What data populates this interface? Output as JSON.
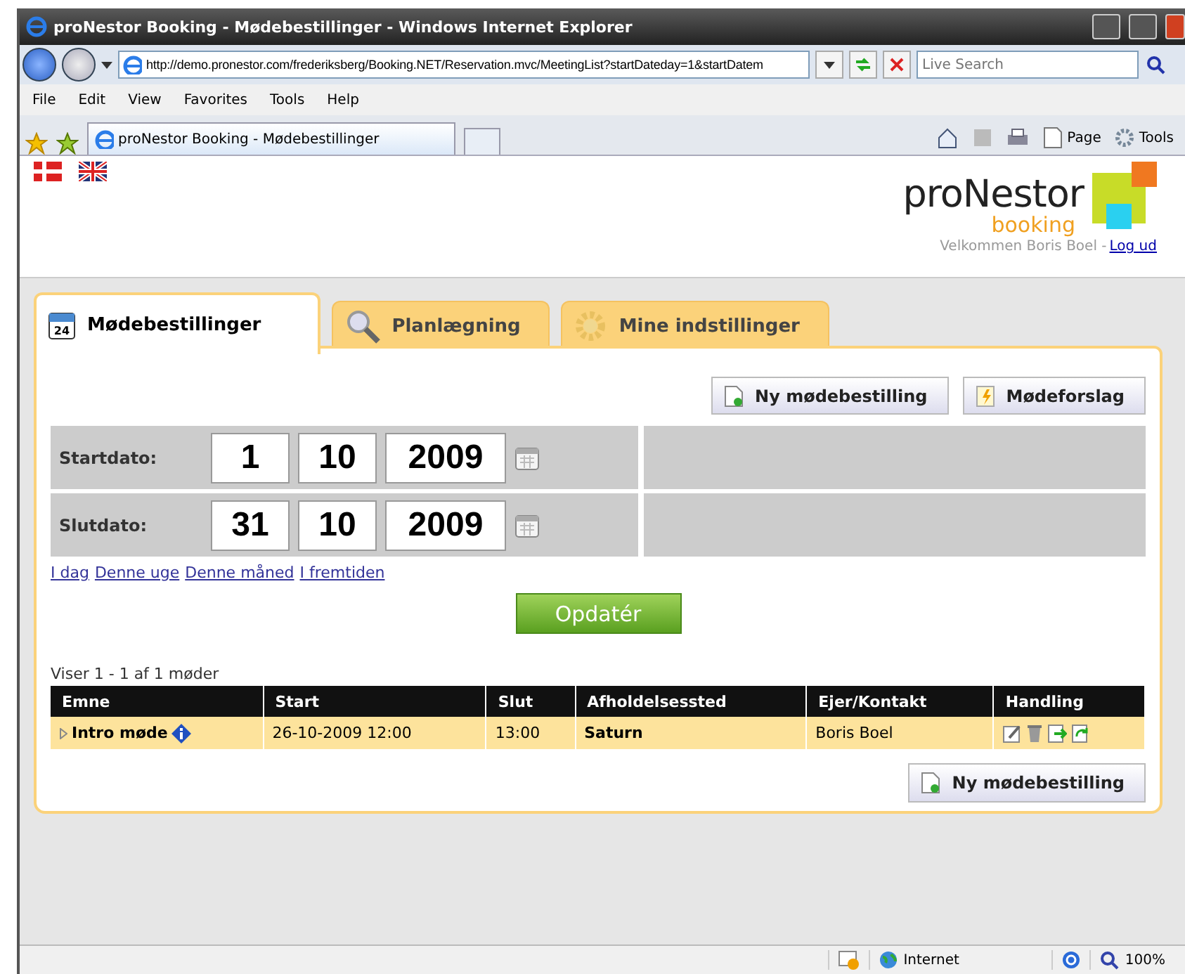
{
  "window": {
    "title": "proNestor Booking - Mødebestillinger - Windows Internet Explorer"
  },
  "address_bar": {
    "url": "http://demo.pronestor.com/frederiksberg/Booking.NET/Reservation.mvc/MeetingList?startDateday=1&startDatem"
  },
  "search": {
    "placeholder": "Live Search"
  },
  "menu": [
    "File",
    "Edit",
    "View",
    "Favorites",
    "Tools",
    "Help"
  ],
  "browser_tabs": [
    {
      "label": "proNestor Booking - Mødebestillinger",
      "selected": true
    }
  ],
  "command_bar": [
    "Page",
    "Tools"
  ],
  "page": {
    "logo": {
      "name": "proNestor",
      "sub": "booking"
    },
    "welcome": "Velkommen Boris Boel -",
    "logout": "Log ud",
    "tabs": [
      {
        "label": "Mødebestillinger",
        "kind": "calendar",
        "icon_text": "24",
        "selected": true
      },
      {
        "label": "Planlægning",
        "kind": "search",
        "selected": false
      },
      {
        "label": "Mine indstillinger",
        "kind": "settings",
        "selected": false
      }
    ],
    "top_buttons": [
      {
        "label": "Ny mødebestilling",
        "kind": "new"
      },
      {
        "label": "Mødeforslag",
        "kind": "suggestion"
      }
    ],
    "dates": [
      {
        "label": "Startdato:",
        "day": "1",
        "month": "10",
        "year": "2009"
      },
      {
        "label": "Slutdato:",
        "day": "31",
        "month": "10",
        "year": "2009"
      }
    ],
    "quick_links": [
      "I dag",
      "Denne uge",
      "Denne måned",
      "I fremtiden"
    ],
    "update_button": "Opdatér",
    "count": "Viser 1 - 1 af 1 møder",
    "table": {
      "columns": [
        "Emne",
        "Start",
        "Slut",
        "Afholdelsessted",
        "Ejer/Kontakt",
        "Handling"
      ],
      "rows": [
        {
          "subject": "Intro møde",
          "start": "26-10-2009 12:00",
          "end": "13:00",
          "location": "Saturn",
          "owner": "Boris Boel",
          "expanded": false
        }
      ]
    },
    "bottom_button": {
      "label": "Ny mødebestilling",
      "kind": "new"
    }
  },
  "status_bar": {
    "zone": "Internet",
    "zoom": "100%"
  }
}
